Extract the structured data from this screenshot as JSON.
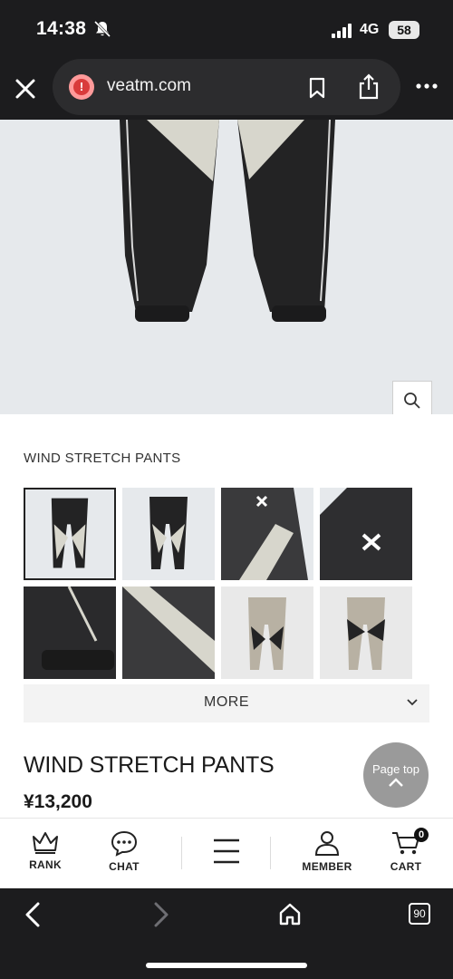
{
  "status_bar": {
    "time": "14:38",
    "network": "4G",
    "battery": "58"
  },
  "browser": {
    "url": "veatm.com",
    "tab_count": "90",
    "warning_glyph": "!"
  },
  "product": {
    "label": "WIND STRETCH PANTS",
    "title": "WIND STRETCH PANTS",
    "price": "¥13,200",
    "more_label": "MORE",
    "thumbnail_count": 8,
    "selected_thumbnail": 1
  },
  "page_top": {
    "label": "Page top"
  },
  "bottom_nav": {
    "items": [
      {
        "label": "RANK",
        "icon": "crown-icon"
      },
      {
        "label": "CHAT",
        "icon": "chat-bubble-icon"
      },
      {
        "label": "",
        "icon": "hamburger-menu-icon"
      },
      {
        "label": "MEMBER",
        "icon": "person-icon"
      },
      {
        "label": "CART",
        "icon": "cart-icon"
      }
    ],
    "cart_count": "0"
  },
  "colors": {
    "chrome_dark": "#1c1c1e",
    "hero_bg": "#e6e9ec",
    "pants_black": "#222222",
    "pants_cream": "#d7d6cc",
    "pants_greige": "#b8b1a3"
  }
}
